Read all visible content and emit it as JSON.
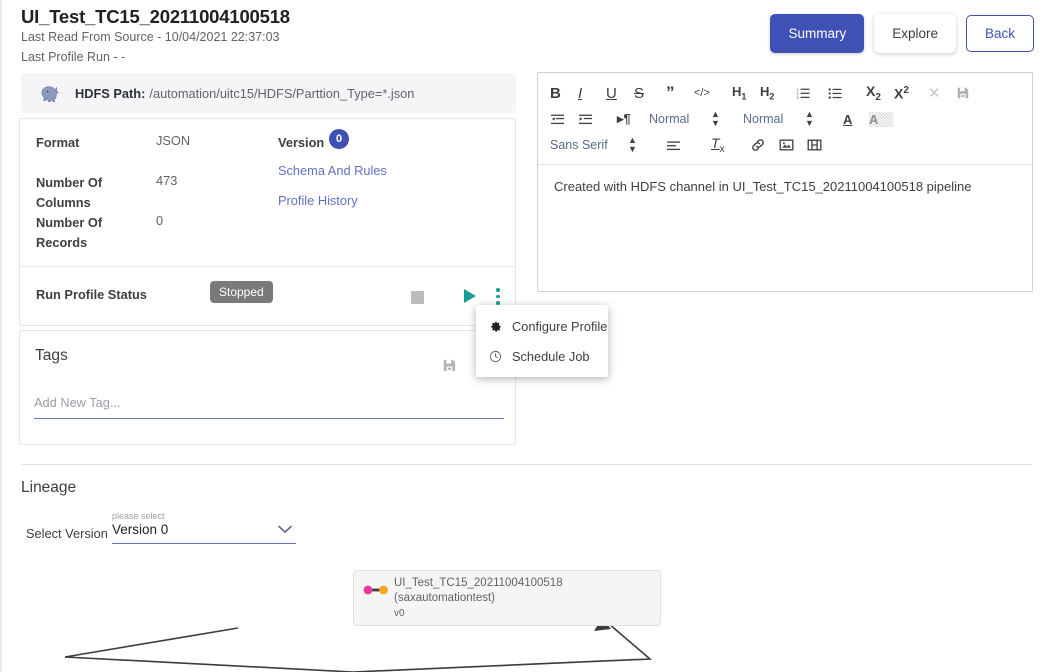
{
  "header": {
    "title": "UI_Test_TC15_20211004100518",
    "last_read": "Last Read From Source - 10/04/2021 22:37:03",
    "last_profile_run": "Last Profile Run - -",
    "buttons": {
      "summary": "Summary",
      "explore": "Explore",
      "back": "Back"
    },
    "accent_color": "#3f51b5"
  },
  "path_bar": {
    "icon": "hadoop-elephant-icon",
    "label": "HDFS Path:",
    "value": "/automation/uitc15/HDFS/Parttion_Type=*.json"
  },
  "info_card": {
    "format_label": "Format",
    "format_value": "JSON",
    "columns_label": "Number Of Columns",
    "columns_value": "473",
    "records_label": "Number Of Records",
    "records_value": "0",
    "version_label": "Version",
    "version_value": "0",
    "schema_link": "Schema And Rules",
    "history_link": "Profile History",
    "run_profile_label": "Run Profile Status",
    "status_badge": "Stopped",
    "status_badge_color": "#7a7a7a",
    "stop_icon": "stop-square-icon",
    "play_icon": "play-triangle-icon",
    "more_icon": "more-vertical-icon",
    "play_color": "#1a9e96"
  },
  "context_menu": {
    "items": [
      {
        "label": "Configure Profile",
        "icon": "gear-icon"
      },
      {
        "label": "Schedule Job",
        "icon": "clock-icon"
      }
    ]
  },
  "tags": {
    "title": "Tags",
    "save_icon": "save-floppy-icon",
    "input_value": "",
    "input_placeholder": "Add New Tag..."
  },
  "editor": {
    "toolbar": {
      "row1": [
        {
          "name": "bold-icon",
          "glyph": "B"
        },
        {
          "name": "italic-icon",
          "glyph": "I"
        },
        {
          "name": "underline-icon",
          "glyph": "U"
        },
        {
          "name": "strikethrough-icon",
          "glyph": "S"
        },
        {
          "name": "blockquote-icon",
          "glyph": "”"
        },
        {
          "name": "code-block-icon",
          "glyph": "</>"
        },
        {
          "name": "heading-1-icon",
          "glyph": "H1"
        },
        {
          "name": "heading-2-icon",
          "glyph": "H2"
        },
        {
          "name": "ordered-list-icon",
          "glyph": "1≡2≡3≡"
        },
        {
          "name": "bullet-list-icon",
          "glyph": "☰"
        },
        {
          "name": "subscript-icon",
          "glyph": "X2"
        },
        {
          "name": "superscript-icon",
          "glyph": "X2"
        },
        {
          "name": "close-icon",
          "glyph": "✕"
        },
        {
          "name": "save-floppy-icon",
          "glyph": "ὋE"
        }
      ],
      "row2": [
        {
          "name": "outdent-icon",
          "glyph": "←≡"
        },
        {
          "name": "indent-icon",
          "glyph": "→≡"
        },
        {
          "name": "text-direction-icon",
          "glyph": "¶"
        }
      ],
      "row2_selects": [
        "Normal",
        "Normal"
      ],
      "row2_colors": [
        {
          "name": "font-color-icon",
          "glyph": "A"
        },
        {
          "name": "highlight-color-icon",
          "glyph": "A"
        }
      ],
      "row3_font": "Sans Serif",
      "row3": [
        {
          "name": "align-icon",
          "glyph": "≡"
        },
        {
          "name": "clear-format-icon",
          "glyph": "Tx"
        },
        {
          "name": "link-icon",
          "glyph": "ὑ7"
        },
        {
          "name": "image-icon",
          "glyph": "ὛC"
        },
        {
          "name": "video-icon",
          "glyph": "ἺC"
        }
      ]
    },
    "content": "Created with HDFS channel in UI_Test_TC15_20211004100518 pipeline"
  },
  "lineage": {
    "title": "Lineage",
    "select_label": "Select Version",
    "select_hint": "please select",
    "select_value": "Version 0",
    "node": {
      "icon": "lineage-connector-icon",
      "title": "UI_Test_TC15_20211004100518",
      "subtitle": "(saxautomationtest)",
      "version": "v0",
      "dot_left_color": "#f0379a",
      "dot_right_color": "#f5a623"
    }
  }
}
